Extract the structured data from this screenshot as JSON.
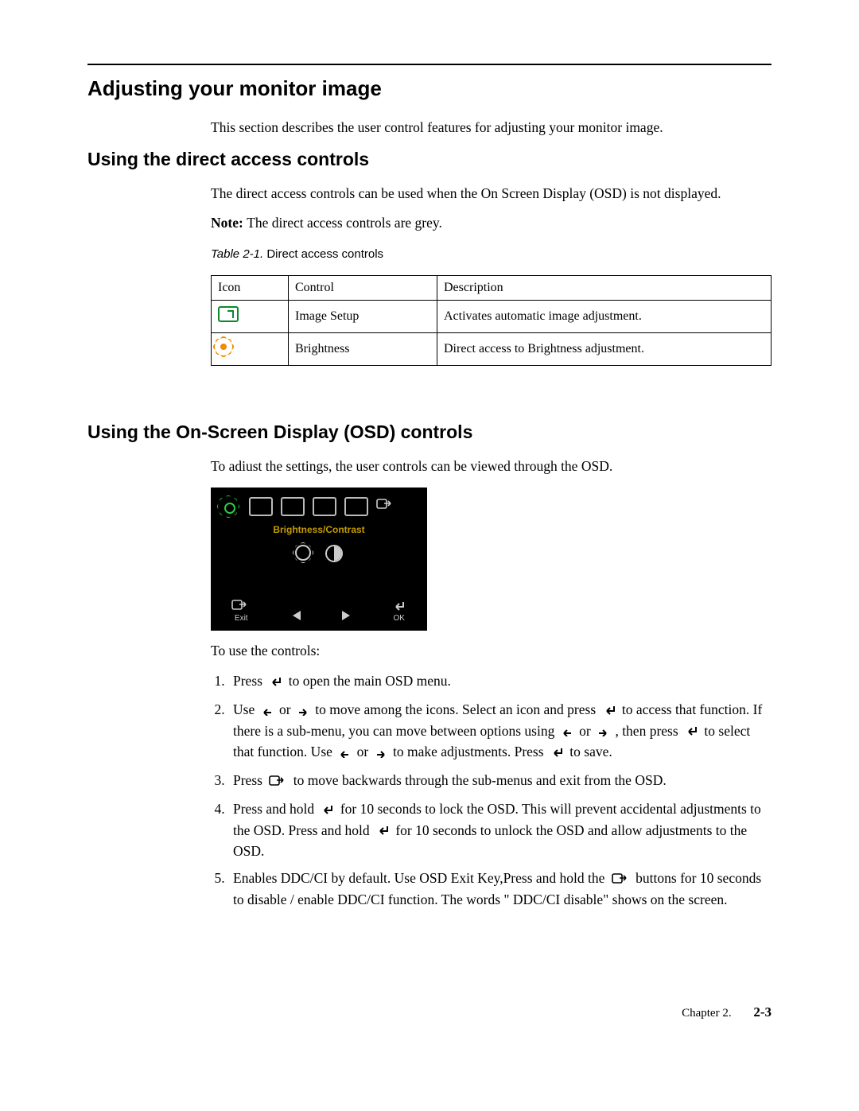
{
  "headings": {
    "h1": "Adjusting your monitor image",
    "h2_direct": "Using the direct access controls",
    "h2_osd": "Using the On-Screen Display (OSD) controls"
  },
  "intro": "This section describes the user control features for adjusting your monitor image.",
  "direct_intro": "The direct access controls can be used when the On Screen Display (OSD) is not displayed.",
  "note_prefix": "Note: ",
  "note_text": "The direct access controls are grey.",
  "table_caption_italic": "Table 2-1.",
  "table_caption_rest": " Direct access controls",
  "table": {
    "head_icon": "Icon",
    "head_control": "Control",
    "head_desc": "Description",
    "rows": [
      {
        "control": "Image Setup",
        "desc": "Activates automatic image adjustment"
      },
      {
        "control": "Brightness",
        "desc": "Direct access to Brightness adjustment"
      }
    ]
  },
  "osd_intro": "To adiust the settings, the user controls can be viewed through the OSD.",
  "osd_panel": {
    "title": "Brightness/Contrast",
    "exit_label": "Exit",
    "ok_label": "OK"
  },
  "to_use": "To use the controls:",
  "steps": {
    "s1_a": "Press ",
    "s1_b": " to open the main OSD menu.",
    "s2_a": "Use ",
    "s2_b": " or ",
    "s2_c": " to move among the icons. Select an icon and press ",
    "s2_d": " to access that function. If there is a sub-menu, you can move between options using ",
    "s2_e": " or ",
    "s2_f": " , then press ",
    "s2_g": " to select that function. Use ",
    "s2_h": " or ",
    "s2_i": " to make adjustments. Press ",
    "s2_j": " to save.",
    "s3_a": "Press ",
    "s3_b": "  to move backwards through the sub-menus and exit from the OSD.",
    "s4_a": "Press and hold ",
    "s4_b": "  for 10 seconds to lock the OSD. This will prevent accidental adjustments to the OSD. Press and hold ",
    "s4_c": "  for 10  seconds to unlock the OSD and allow adjustments to the OSD.",
    "s5_a": "Enables DDC/CI by default. Use OSD Exit Key,Press and hold the ",
    "s5_b": "  buttons  for 10 seconds to disable / enable DDC/CI function. The words \" DDC/CI disable\" shows on the screen."
  },
  "footer": {
    "chapter": "Chapter 2.",
    "page": "2-3"
  }
}
